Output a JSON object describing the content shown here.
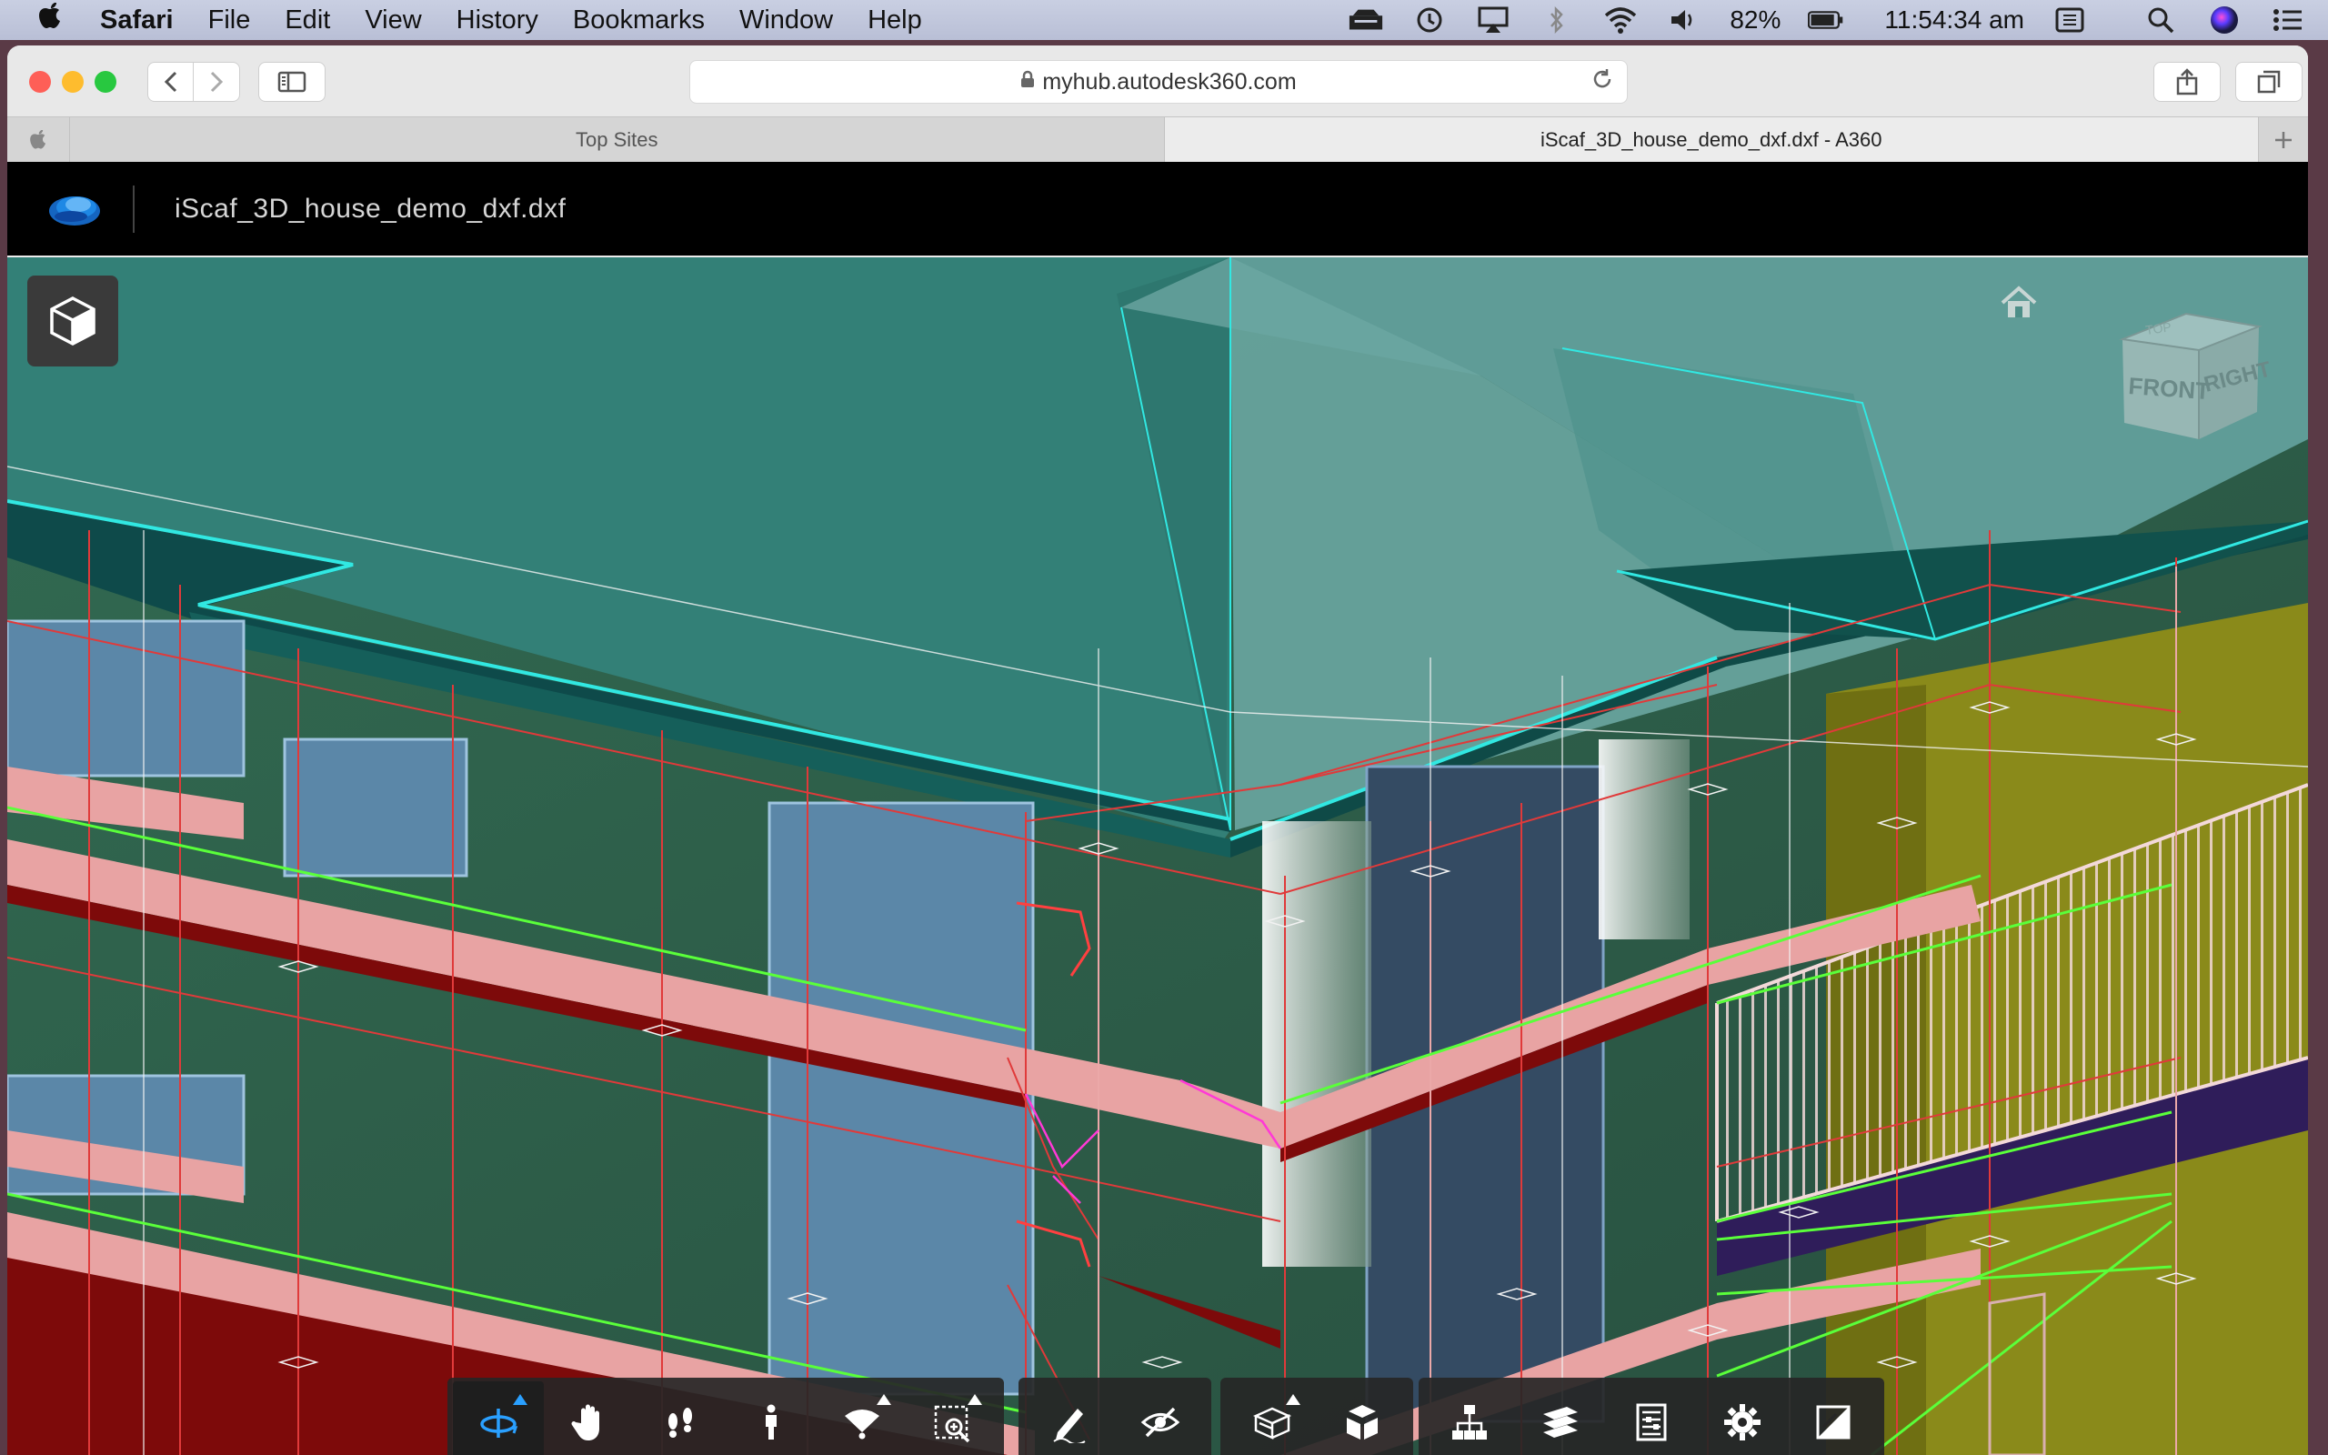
{
  "menubar": {
    "app_name": "Safari",
    "items": [
      "File",
      "Edit",
      "View",
      "History",
      "Bookmarks",
      "Window",
      "Help"
    ],
    "battery": "82%",
    "clock": "11:54:34 am"
  },
  "browser": {
    "url": "myhub.autodesk360.com",
    "tabs": [
      {
        "label": "Top Sites",
        "active": false
      },
      {
        "label": "iScaf_3D_house_demo_dxf.dxf - A360",
        "active": true
      }
    ]
  },
  "viewer": {
    "document_name": "iScaf_3D_house_demo_dxf.dxf",
    "viewcube": {
      "front": "FRONT",
      "right": "RIGHT",
      "top": "TOP"
    },
    "toolbar_icons": [
      "orbit-icon",
      "pan-icon",
      "first-person-icon",
      "walk-icon",
      "camera-interactions-icon",
      "zoom-window-icon",
      "markup-icon",
      "hide-icon",
      "section-icon",
      "explode-icon",
      "model-browser-icon",
      "layers-icon",
      "properties-icon",
      "settings-icon",
      "fullscreen-icon"
    ]
  },
  "colors": {
    "roof": "#3c9a93",
    "wall": "#2f5f4a",
    "plank": "#e8a3a3",
    "plank_edge": "#7d0a0a",
    "scaffold_pole": "#e03a3a",
    "railing": "#5aff3a",
    "toolbar_bg": "#262626",
    "accent": "#2aa0ff"
  }
}
